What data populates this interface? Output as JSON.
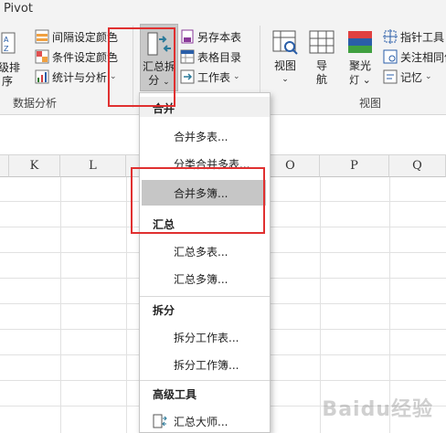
{
  "tab": {
    "label": "Pivot"
  },
  "ribbon": {
    "partial_big_button_label_1": "级排",
    "partial_big_button_label_2": "序",
    "group_data_analysis": {
      "label": "数据分析",
      "items": [
        {
          "label": "间隔设定颜色"
        },
        {
          "label": "条件设定颜色"
        },
        {
          "label": "统计与分析",
          "dropdown": true
        }
      ]
    },
    "summary_split": {
      "line1": "汇总拆",
      "line2": "分",
      "chevron": "⌄"
    },
    "group_misc": {
      "items": [
        {
          "label": "另存本表"
        },
        {
          "label": "表格目录"
        },
        {
          "label": "工作表",
          "dropdown": true
        }
      ]
    },
    "group_view": {
      "label": "视图",
      "view_button": {
        "line1": "视图",
        "line2": "⌄"
      },
      "nav_button": {
        "line1": "导",
        "line2": "航"
      },
      "spotlight_button": {
        "line1": "聚光",
        "line2": "灯 ⌄"
      },
      "items": [
        {
          "label": "指针工具"
        },
        {
          "label": "关注相同值"
        },
        {
          "label": "记忆",
          "dropdown": true
        }
      ]
    }
  },
  "columns": [
    "K",
    "L",
    "O",
    "P",
    "Q"
  ],
  "menu": {
    "sections": [
      {
        "title": "合并",
        "items": [
          "合并多表...",
          "分类合并多表...",
          "合并多簿..."
        ]
      },
      {
        "title": "汇总",
        "items": [
          "汇总多表...",
          "汇总多簿..."
        ]
      },
      {
        "title": "拆分",
        "items": [
          "拆分工作表...",
          "拆分工作簿..."
        ]
      },
      {
        "title": "高级工具",
        "items": [
          "汇总大师..."
        ]
      }
    ]
  },
  "watermark": "Baidu经验",
  "colors": {
    "highlight_box": "#e03030",
    "menu_hover": "#c6c6c6",
    "ribbon_bg": "#f3f3f3"
  }
}
